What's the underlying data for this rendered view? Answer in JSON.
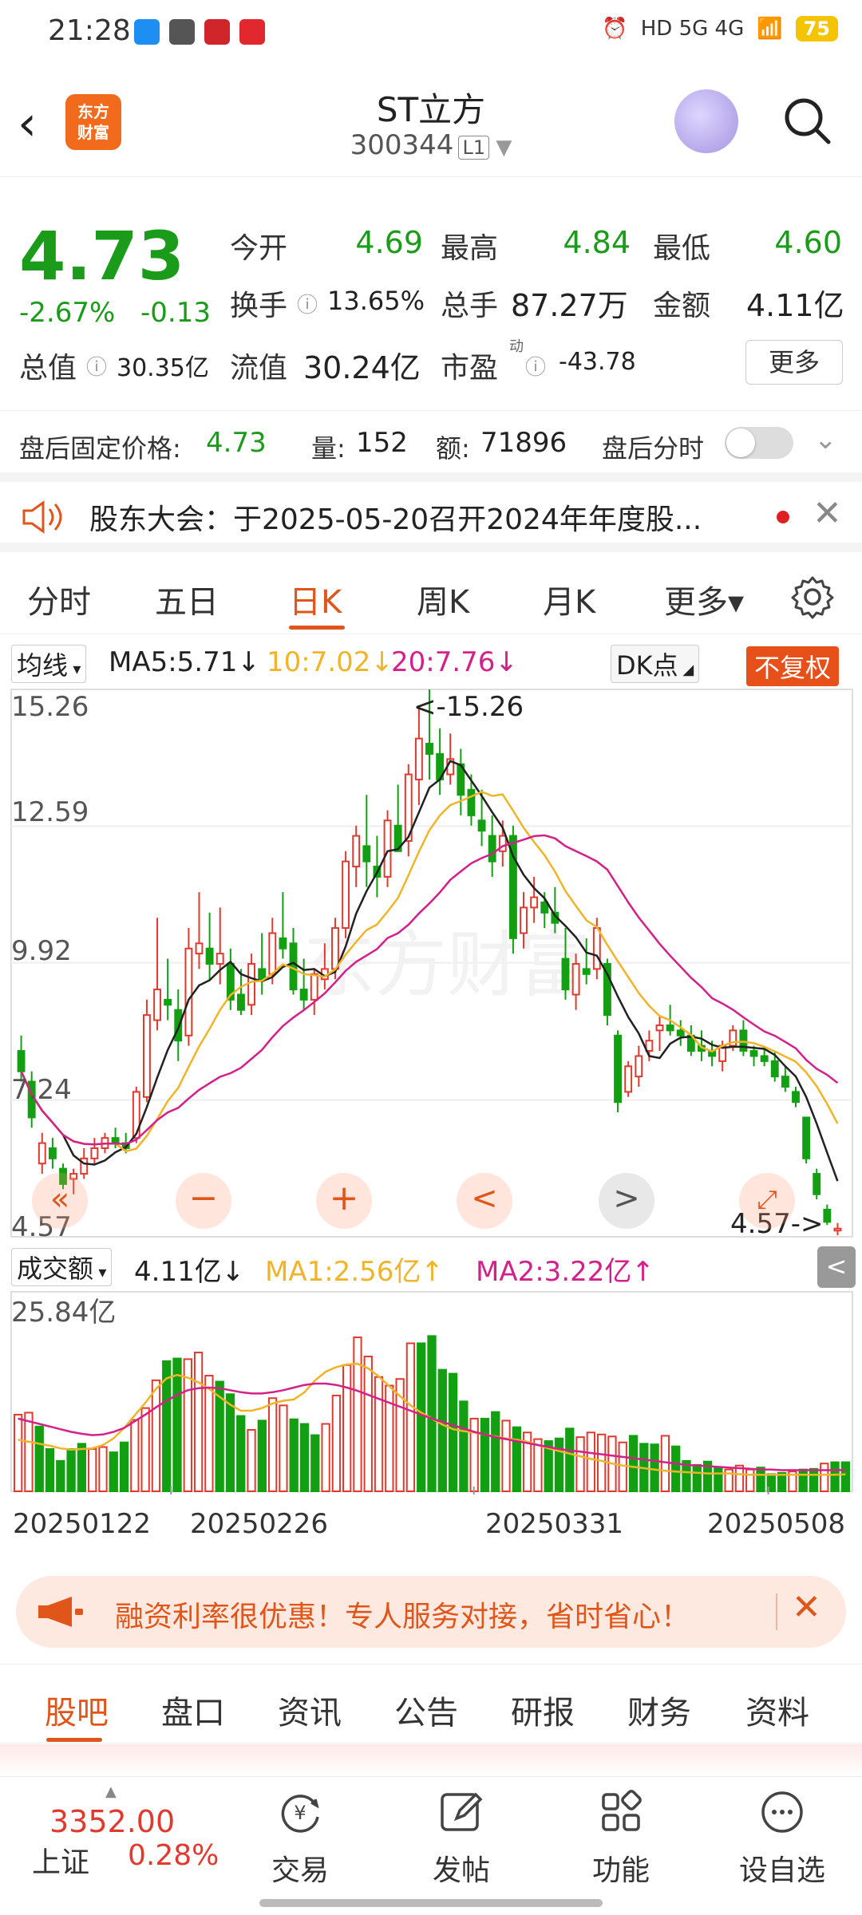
{
  "status_bar": {
    "time": "21:28",
    "network": "HD 5G 4G",
    "battery": "75"
  },
  "header": {
    "logo_line1": "东方",
    "logo_line2": "财富",
    "title": "ST立方",
    "code": "300344",
    "level": "L1"
  },
  "quote": {
    "price": "4.73",
    "change_pct": "-2.67%",
    "change": "-0.13",
    "open_label": "今开",
    "open": "4.69",
    "high_label": "最高",
    "high": "4.84",
    "low_label": "最低",
    "low": "4.60",
    "turnover_label": "换手",
    "turnover": "13.65%",
    "volume_label": "总手",
    "volume": "87.27万",
    "amount_label": "金额",
    "amount": "4.11亿",
    "mktcap_label": "总值",
    "mktcap": "30.35亿",
    "float_label": "流值",
    "float": "30.24亿",
    "pe_label": "市盈",
    "pe_sup": "动",
    "pe": "-43.78",
    "more_label": "更多"
  },
  "after_hours": {
    "price_label": "盘后固定价格:",
    "price": "4.73",
    "vol_label": "量:",
    "vol": "152",
    "amt_label": "额:",
    "amt": "71896",
    "timeshare_label": "盘后分时"
  },
  "notice": {
    "text": "股东大会：于2025-05-20召开2024年年度股..."
  },
  "k_tabs": [
    "分时",
    "五日",
    "日K",
    "周K",
    "月K",
    "更多▾"
  ],
  "k_tab_active": 2,
  "ma_bar": {
    "selector": "均线",
    "ma5": "MA5:5.71↓",
    "ma10": "10:7.02↓",
    "ma20": "20:7.76↓",
    "dk": "DK点",
    "adjust": "不复权",
    "colors": {
      "ma5": "#222222",
      "ma10": "#f0b429",
      "ma20": "#d4208a",
      "up": "#e03a2f",
      "down": "#12a012"
    }
  },
  "chart_controls": {
    "left": "«",
    "zoom_out": "−",
    "zoom_in": "+",
    "prev": "<",
    "next": ">"
  },
  "vol_bar": {
    "selector": "成交额",
    "value": "4.11亿↓",
    "ma1": "MA1:2.56亿↑",
    "ma2": "MA2:3.22亿↑",
    "collapse": "<"
  },
  "chart_data": [
    {
      "type": "candlestick",
      "y_ticks": [
        "15.26",
        "12.59",
        "9.92",
        "7.24",
        "4.57"
      ],
      "ylim": [
        4.57,
        15.26
      ],
      "max_marker": "<-15.26",
      "min_marker": "4.57->",
      "x_ticks": [
        "20250122",
        "20250226",
        "20250331",
        "20250508"
      ],
      "candles": [
        [
          8.2,
          8.5,
          7.6,
          7.8
        ],
        [
          7.6,
          7.8,
          6.7,
          6.9
        ],
        [
          6.0,
          6.6,
          5.8,
          6.4
        ],
        [
          6.3,
          6.5,
          5.9,
          6.1
        ],
        [
          5.9,
          6.0,
          5.5,
          5.6
        ],
        [
          5.7,
          5.9,
          5.4,
          5.8
        ],
        [
          5.8,
          6.3,
          5.7,
          6.1
        ],
        [
          6.1,
          6.5,
          6.0,
          6.3
        ],
        [
          6.3,
          6.6,
          6.2,
          6.5
        ],
        [
          6.5,
          6.7,
          6.3,
          6.4
        ],
        [
          6.4,
          6.6,
          6.2,
          6.3
        ],
        [
          6.5,
          7.5,
          6.4,
          7.4
        ],
        [
          7.3,
          9.2,
          7.2,
          8.9
        ],
        [
          8.8,
          10.8,
          8.6,
          9.4
        ],
        [
          9.2,
          10.0,
          8.8,
          9.1
        ],
        [
          9.0,
          9.4,
          8.0,
          8.4
        ],
        [
          8.5,
          10.6,
          8.3,
          10.2
        ],
        [
          10.1,
          11.3,
          9.8,
          10.3
        ],
        [
          10.2,
          10.9,
          9.6,
          9.9
        ],
        [
          9.9,
          11.0,
          9.5,
          10.1
        ],
        [
          9.9,
          10.2,
          9.0,
          9.2
        ],
        [
          9.3,
          9.8,
          8.9,
          9.0
        ],
        [
          9.1,
          10.1,
          8.9,
          9.9
        ],
        [
          9.8,
          10.5,
          9.3,
          9.6
        ],
        [
          9.7,
          10.8,
          9.5,
          10.5
        ],
        [
          10.4,
          11.3,
          10.0,
          10.2
        ],
        [
          10.3,
          10.6,
          9.3,
          9.4
        ],
        [
          9.4,
          10.0,
          9.0,
          9.2
        ],
        [
          9.2,
          9.8,
          8.9,
          9.7
        ],
        [
          9.6,
          10.3,
          9.4,
          9.8
        ],
        [
          9.8,
          10.8,
          9.6,
          10.6
        ],
        [
          10.6,
          12.1,
          10.4,
          11.9
        ],
        [
          11.8,
          12.6,
          11.4,
          12.4
        ],
        [
          12.2,
          13.2,
          11.4,
          11.9
        ],
        [
          11.8,
          12.4,
          11.2,
          11.6
        ],
        [
          11.6,
          12.9,
          11.4,
          12.7
        ],
        [
          12.6,
          13.4,
          12.2,
          12.1
        ],
        [
          12.3,
          13.8,
          12.0,
          13.6
        ],
        [
          13.5,
          14.9,
          13.0,
          14.3
        ],
        [
          14.2,
          15.26,
          13.5,
          14.0
        ],
        [
          14.0,
          14.5,
          13.2,
          13.5
        ],
        [
          13.6,
          14.4,
          13.4,
          13.9
        ],
        [
          13.8,
          14.1,
          12.8,
          13.2
        ],
        [
          13.3,
          13.6,
          12.6,
          12.8
        ],
        [
          12.7,
          13.3,
          12.2,
          12.5
        ],
        [
          12.4,
          12.8,
          11.6,
          11.9
        ],
        [
          12.1,
          12.7,
          11.8,
          12.4
        ],
        [
          12.4,
          12.6,
          10.1,
          10.4
        ],
        [
          10.5,
          11.3,
          10.2,
          11.0
        ],
        [
          11.0,
          11.6,
          10.7,
          11.2
        ],
        [
          11.1,
          11.3,
          10.6,
          10.9
        ],
        [
          10.9,
          11.4,
          10.5,
          10.7
        ],
        [
          10.0,
          10.6,
          9.2,
          9.4
        ],
        [
          9.3,
          10.1,
          9.0,
          9.9
        ],
        [
          9.8,
          10.4,
          9.5,
          9.7
        ],
        [
          9.8,
          10.8,
          9.6,
          10.6
        ],
        [
          9.9,
          10.0,
          8.7,
          8.9
        ],
        [
          8.5,
          8.6,
          7.0,
          7.2
        ],
        [
          7.4,
          8.0,
          7.3,
          7.9
        ],
        [
          7.7,
          8.3,
          7.5,
          8.1
        ],
        [
          8.2,
          8.6,
          8.0,
          8.4
        ],
        [
          8.6,
          8.9,
          8.2,
          8.7
        ],
        [
          8.7,
          9.1,
          8.5,
          8.6
        ],
        [
          8.6,
          8.8,
          8.3,
          8.5
        ],
        [
          8.5,
          8.7,
          8.1,
          8.2
        ],
        [
          8.3,
          8.6,
          8.0,
          8.2
        ],
        [
          8.2,
          8.4,
          7.9,
          8.1
        ],
        [
          8.0,
          8.4,
          7.8,
          8.3
        ],
        [
          8.3,
          8.7,
          8.2,
          8.6
        ],
        [
          8.6,
          8.8,
          8.1,
          8.2
        ],
        [
          8.2,
          8.3,
          7.9,
          8.1
        ],
        [
          8.1,
          8.3,
          7.9,
          8.0
        ],
        [
          8.0,
          8.2,
          7.6,
          7.7
        ],
        [
          7.7,
          7.9,
          7.4,
          7.5
        ],
        [
          7.4,
          7.5,
          7.1,
          7.2
        ],
        [
          6.9,
          6.9,
          6.0,
          6.1
        ],
        [
          5.8,
          5.9,
          5.3,
          5.4
        ],
        [
          5.1,
          5.2,
          4.8,
          4.86
        ],
        [
          4.69,
          4.84,
          4.6,
          4.73
        ]
      ]
    },
    {
      "type": "bar",
      "title": "成交额",
      "y_ticks": [
        "25.84亿"
      ],
      "ylim": [
        0,
        25.84
      ],
      "up_down": "uuddddduudduuudduuuddduduuddduuuuuuuuudddddudduduuddduuuuuddduddddduuudddudduddddd",
      "values": [
        11.6,
        11.9,
        9.8,
        6.4,
        4.6,
        6.4,
        7.2,
        6.4,
        6.7,
        5.9,
        7.4,
        10.8,
        12.6,
        16.8,
        19.7,
        20.1,
        20.0,
        21.0,
        17.5,
        16.6,
        14.7,
        11.4,
        9.3,
        10.7,
        14.1,
        13.0,
        10.9,
        10.2,
        8.5,
        10.2,
        14.5,
        19.1,
        23.3,
        20.4,
        17.3,
        16.0,
        17.0,
        22.4,
        22.4,
        23.5,
        18.4,
        17.8,
        13.6,
        11.0,
        11.0,
        12.0,
        10.7,
        9.7,
        8.9,
        7.9,
        7.6,
        8.0,
        9.5,
        8.2,
        8.9,
        8.6,
        8.3,
        7.4,
        8.4,
        7.2,
        7.1,
        8.4,
        6.8,
        4.6,
        4.0,
        4.5,
        3.6,
        3.3,
        3.9,
        3.3,
        3.6,
        2.6,
        2.8,
        3.0,
        3.3,
        3.4,
        4.2,
        4.4,
        4.4
      ],
      "ma1": [
        7.8,
        7.5,
        7.2,
        6.9,
        6.5,
        6.3,
        6.4,
        6.5,
        7.0,
        8.0,
        9.6,
        11.5,
        13.4,
        15.5,
        17.1,
        17.6,
        17.2,
        16.5,
        15.5,
        14.3,
        13.1,
        12.2,
        12.2,
        12.6,
        13.3,
        13.7,
        13.9,
        15.0,
        16.8,
        18.1,
        18.8,
        19.2,
        19.3,
        18.6,
        17.4,
        15.9,
        14.4,
        13.0,
        11.9,
        11.0,
        10.1,
        9.4,
        9.1,
        8.9,
        8.6,
        8.3,
        8.0,
        7.8,
        7.5,
        7.0,
        6.5,
        6.1,
        5.7,
        5.3,
        4.9,
        4.6,
        4.2,
        3.9,
        3.7,
        3.5,
        3.3,
        3.1,
        3.0,
        2.9,
        2.8,
        2.7,
        2.7,
        2.7,
        2.6,
        2.5,
        2.5,
        2.5,
        2.5,
        2.5,
        2.5,
        2.5,
        2.5,
        2.5,
        2.56
      ],
      "ma2": [
        11.0,
        10.6,
        10.2,
        9.8,
        9.4,
        9.0,
        8.7,
        8.5,
        8.6,
        9.0,
        9.6,
        10.6,
        11.6,
        12.7,
        13.7,
        14.6,
        15.3,
        15.6,
        15.7,
        15.6,
        15.3,
        15.0,
        14.8,
        14.8,
        15.0,
        15.3,
        15.7,
        16.1,
        16.3,
        16.3,
        16.1,
        15.7,
        15.2,
        14.6,
        14.0,
        13.4,
        12.8,
        12.2,
        11.6,
        11.0,
        10.5,
        10.0,
        9.5,
        9.0,
        8.6,
        8.2,
        7.9,
        7.6,
        7.3,
        7.0,
        6.7,
        6.4,
        6.2,
        6.0,
        5.8,
        5.6,
        5.4,
        5.2,
        5.0,
        4.8,
        4.6,
        4.4,
        4.2,
        4.0,
        3.9,
        3.8,
        3.7,
        3.6,
        3.5,
        3.4,
        3.3,
        3.3,
        3.2,
        3.2,
        3.2,
        3.2,
        3.2,
        3.2,
        3.22
      ]
    }
  ],
  "promo": {
    "text": "融资利率很优惠！专人服务对接，省时省心！"
  },
  "bottom_tabs": [
    "股吧",
    "盘口",
    "资讯",
    "公告",
    "研报",
    "财务",
    "资料"
  ],
  "bottom_tab_active": 0,
  "index": {
    "value": "3352.00",
    "name": "上证",
    "pct": "0.28%"
  },
  "nav": [
    "交易",
    "发帖",
    "功能",
    "设自选"
  ]
}
